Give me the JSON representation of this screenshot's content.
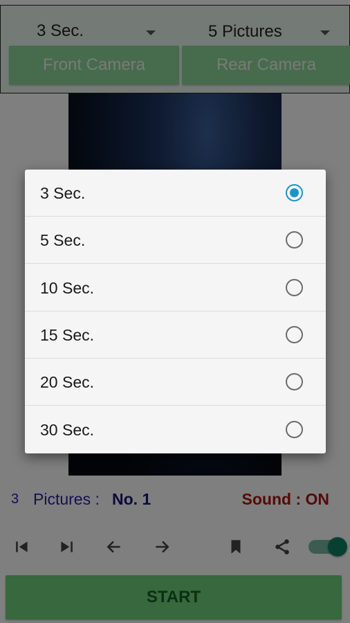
{
  "top_bar": {
    "delay_spinner": "3 Sec.",
    "count_spinner": "5 Pictures",
    "front_camera_label": "Front Camera",
    "rear_camera_label": "Rear Camera"
  },
  "info": {
    "picture_count": "3",
    "pictures_label": "Pictures :",
    "pictures_value": "No. 1",
    "sound": "Sound : ON"
  },
  "toolbar": {
    "icons": [
      "skip-previous-icon",
      "skip-next-icon",
      "arrow-left-icon",
      "arrow-right-icon",
      "bookmark-icon",
      "share-icon"
    ],
    "sound_toggle_on": true
  },
  "start_label": "START",
  "dialog": {
    "options": [
      {
        "label": "3 Sec.",
        "selected": true
      },
      {
        "label": "5 Sec.",
        "selected": false
      },
      {
        "label": "10 Sec.",
        "selected": false
      },
      {
        "label": "15 Sec.",
        "selected": false
      },
      {
        "label": "20 Sec.",
        "selected": false
      },
      {
        "label": "30 Sec.",
        "selected": false
      }
    ]
  },
  "colors": {
    "accent_radio": "#1d94c9",
    "button_green": "#6fd07c",
    "info_blue": "#2323a8",
    "sound_red": "#b01010",
    "toggle": "#0e8066"
  }
}
